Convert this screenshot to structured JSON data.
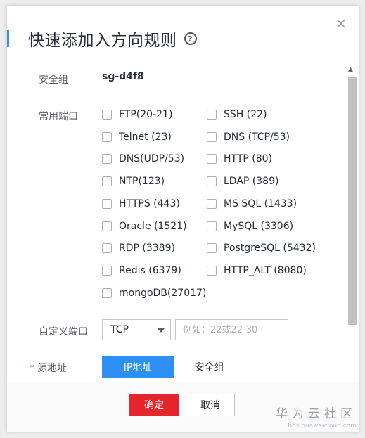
{
  "dialog": {
    "title": "快速添加入方向规则",
    "help_icon": "?",
    "close_icon": "×"
  },
  "security_group": {
    "label": "安全组",
    "value": "sg-d4f8"
  },
  "common_ports": {
    "label": "常用端口",
    "options": [
      {
        "label": "FTP(20-21)",
        "checked": false
      },
      {
        "label": "SSH (22)",
        "checked": false
      },
      {
        "label": "Telnet (23)",
        "checked": false
      },
      {
        "label": "DNS (TCP/53)",
        "checked": false
      },
      {
        "label": "DNS(UDP/53)",
        "checked": false
      },
      {
        "label": "HTTP (80)",
        "checked": false
      },
      {
        "label": "NTP(123)",
        "checked": false
      },
      {
        "label": "LDAP (389)",
        "checked": false
      },
      {
        "label": "HTTPS (443)",
        "checked": false
      },
      {
        "label": "MS SQL (1433)",
        "checked": false
      },
      {
        "label": "Oracle (1521)",
        "checked": false
      },
      {
        "label": "MySQL (3306)",
        "checked": false
      },
      {
        "label": "RDP (3389)",
        "checked": false
      },
      {
        "label": "PostgreSQL (5432)",
        "checked": false
      },
      {
        "label": "Redis (6379)",
        "checked": false
      },
      {
        "label": "HTTP_ALT (8080)",
        "checked": false
      },
      {
        "label": "mongoDB(27017)",
        "checked": false
      }
    ]
  },
  "custom_port": {
    "label": "自定义端口",
    "protocol": "TCP",
    "placeholder": "例如：22或22-30",
    "value": ""
  },
  "source": {
    "required_mark": "*",
    "label": "源地址",
    "options": [
      "IP地址",
      "安全组"
    ],
    "selected": "IP地址"
  },
  "footer": {
    "ok_label": "确定",
    "cancel_label": "取消"
  },
  "watermark": {
    "brand": "华为云社区",
    "url": "bbs.huaweicloud.com"
  },
  "colors": {
    "accent": "#2e8ff5",
    "primary_button": "#e4262c",
    "required": "#f66f6a"
  }
}
